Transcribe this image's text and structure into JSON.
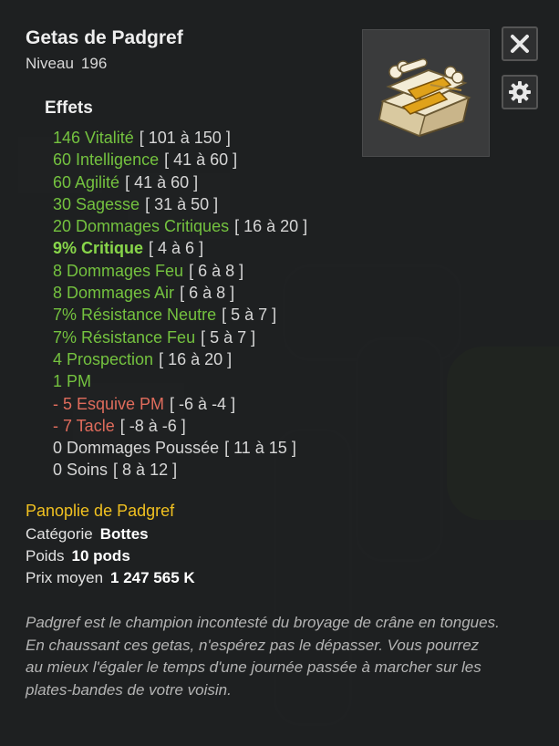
{
  "item": {
    "name": "Getas de Padgref",
    "level_label": "Niveau",
    "level_value": "196",
    "image_icon": "bone-wrapped-boots-icon"
  },
  "buttons": {
    "close_icon": "close-icon",
    "settings_icon": "gear-icon"
  },
  "effects_title": "Effets",
  "effects": [
    {
      "text": "146 Vitalité",
      "range": "[ 101 à 150 ]",
      "kind": "pos"
    },
    {
      "text": "60 Intelligence",
      "range": "[ 41 à 60 ]",
      "kind": "pos"
    },
    {
      "text": "60 Agilité",
      "range": "[ 41 à 60 ]",
      "kind": "pos"
    },
    {
      "text": "30 Sagesse",
      "range": "[ 31 à 50 ]",
      "kind": "pos"
    },
    {
      "text": "20 Dommages Critiques",
      "range": "[ 16 à 20 ]",
      "kind": "pos"
    },
    {
      "text": "9% Critique",
      "range": "[ 4 à 6 ]",
      "kind": "pos-bold"
    },
    {
      "text": "8 Dommages Feu",
      "range": "[ 6 à 8 ]",
      "kind": "pos"
    },
    {
      "text": "8 Dommages Air",
      "range": "[ 6 à 8 ]",
      "kind": "pos"
    },
    {
      "text": "7% Résistance Neutre",
      "range": "[ 5 à 7 ]",
      "kind": "pos"
    },
    {
      "text": "7% Résistance Feu",
      "range": "[ 5 à 7 ]",
      "kind": "pos"
    },
    {
      "text": "4 Prospection",
      "range": "[ 16 à 20 ]",
      "kind": "pos"
    },
    {
      "text": "1 PM",
      "range": "",
      "kind": "pos"
    },
    {
      "text": "- 5 Esquive PM",
      "range": "[ -6 à -4 ]",
      "kind": "neg"
    },
    {
      "text": "- 7 Tacle",
      "range": "[ -8 à -6 ]",
      "kind": "neg"
    },
    {
      "text": "0 Dommages Poussée",
      "range": "[ 11 à 15 ]",
      "kind": "zero"
    },
    {
      "text": "0 Soins",
      "range": "[ 8 à 12 ]",
      "kind": "zero"
    }
  ],
  "set_name": "Panoplie de Padgref",
  "category": {
    "label": "Catégorie",
    "value": "Bottes"
  },
  "weight": {
    "label": "Poids",
    "value": "10 pods"
  },
  "price": {
    "label": "Prix moyen",
    "value": "1 247 565 K"
  },
  "description": "Padgref est le champion incontesté du broyage de crâne en tongues. En chaussant ces getas, n'espérez pas le dépasser. Vous pourrez au mieux l'égaler le temps d'une journée passée à marcher sur les plates-bandes de votre voisin.",
  "colors": {
    "positive": "#74c23f",
    "negative": "#e06c5c",
    "neutral": "#d6d6d6",
    "set": "#f0c020"
  }
}
